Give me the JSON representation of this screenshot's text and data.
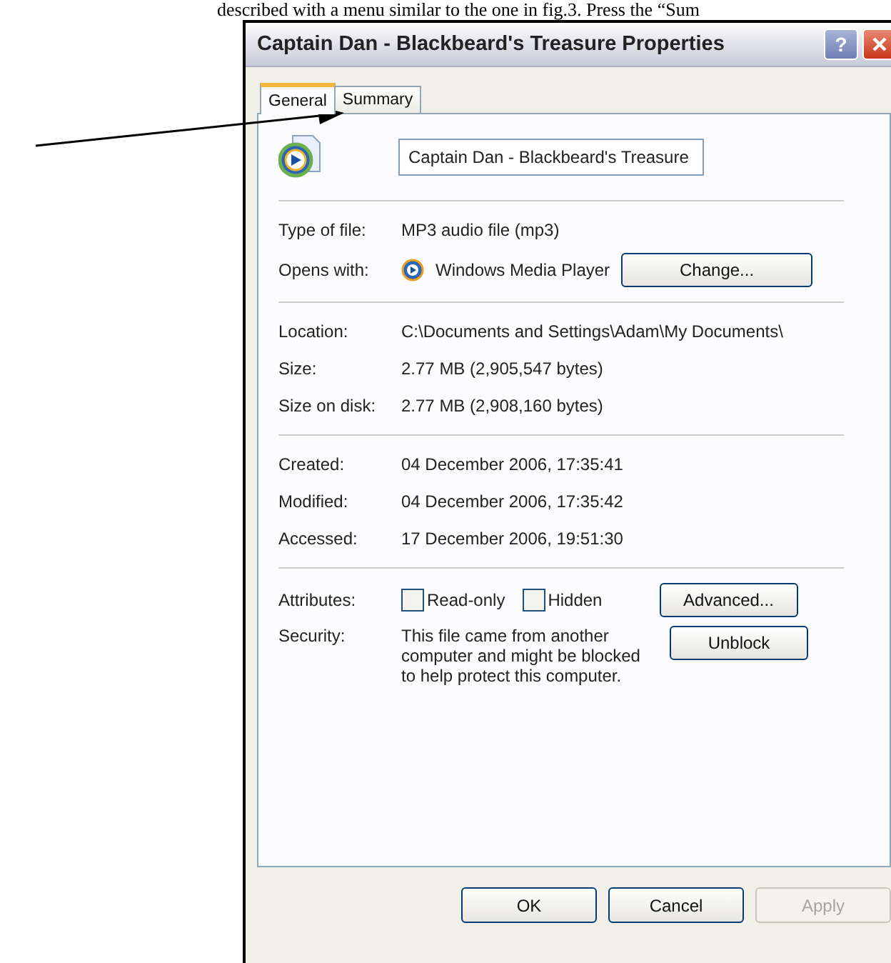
{
  "document_text": "described with a menu similar to the one in fig.3. Press the “Sum",
  "window": {
    "title": "Captain Dan - Blackbeard's Treasure Properties",
    "help_button": "?"
  },
  "tabs": [
    {
      "label": "General",
      "selected": true
    },
    {
      "label": "Summary",
      "selected": false
    }
  ],
  "file_name": {
    "value": "Captain Dan - Blackbeard's Treasure"
  },
  "sections": [
    {
      "rows": [
        {
          "kind": "text",
          "label": "Type of file:",
          "value": "MP3 audio file (mp3)"
        },
        {
          "kind": "app",
          "label": "Opens with:",
          "value": "Windows Media Player",
          "button": "Change..."
        }
      ]
    },
    {
      "rows": [
        {
          "kind": "text",
          "label": "Location:",
          "value": "C:\\Documents and Settings\\Adam\\My Documents\\"
        },
        {
          "kind": "text",
          "label": "Size:",
          "value": "2.77 MB (2,905,547 bytes)"
        },
        {
          "kind": "text",
          "label": "Size on disk:",
          "value": "2.77 MB (2,908,160 bytes)"
        }
      ]
    },
    {
      "rows": [
        {
          "kind": "text",
          "label": "Created:",
          "value": "04 December 2006, 17:35:41"
        },
        {
          "kind": "text",
          "label": "Modified:",
          "value": "04 December 2006, 17:35:42"
        },
        {
          "kind": "text",
          "label": "Accessed:",
          "value": "17 December 2006, 19:51:30"
        }
      ]
    },
    {
      "rows": [
        {
          "kind": "attributes",
          "label": "Attributes:",
          "checkboxes": [
            {
              "label": "Read-only",
              "checked": false
            },
            {
              "label": "Hidden",
              "checked": false
            }
          ],
          "button": "Advanced..."
        },
        {
          "kind": "security",
          "label": "Security:",
          "value": "This file came from another computer and might be blocked to help protect this computer.",
          "button": "Unblock"
        }
      ]
    }
  ],
  "buttons": [
    {
      "label": "OK",
      "disabled": false
    },
    {
      "label": "Cancel",
      "disabled": false
    },
    {
      "label": "Apply",
      "disabled": true
    }
  ]
}
